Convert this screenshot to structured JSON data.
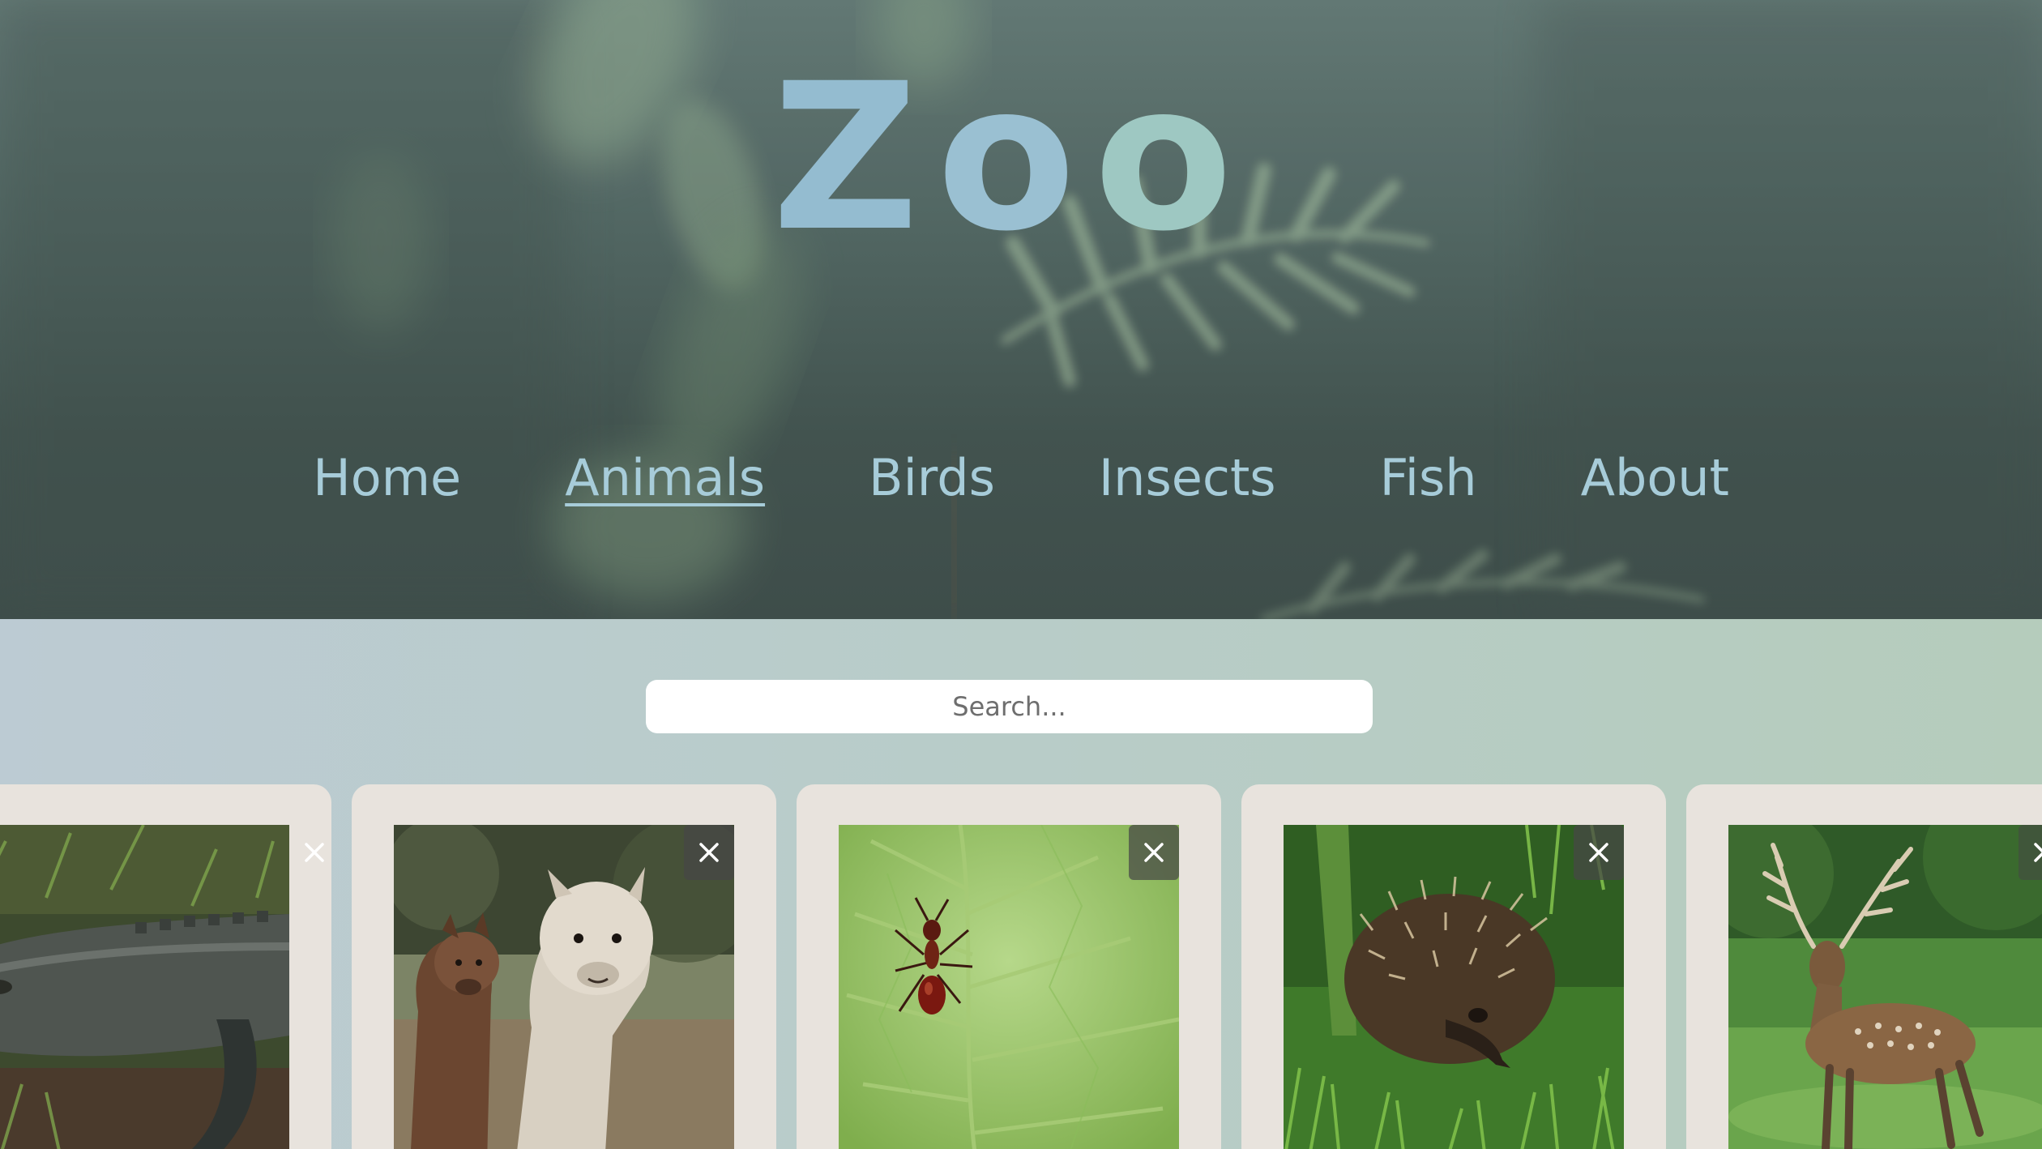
{
  "logo": {
    "letters": [
      "Z",
      "o",
      "o"
    ]
  },
  "nav": {
    "items": [
      {
        "label": "Home"
      },
      {
        "label": "Animals"
      },
      {
        "label": "Birds"
      },
      {
        "label": "Insects"
      },
      {
        "label": "Fish"
      },
      {
        "label": "About"
      }
    ],
    "active": "Animals"
  },
  "search": {
    "placeholder": "Search...",
    "value": ""
  },
  "cards": [
    {
      "animal": "alligator",
      "remove_icon": "close-icon"
    },
    {
      "animal": "alpaca",
      "remove_icon": "close-icon"
    },
    {
      "animal": "ant",
      "remove_icon": "close-icon"
    },
    {
      "animal": "echidna",
      "remove_icon": "close-icon"
    },
    {
      "animal": "deer",
      "remove_icon": "close-icon"
    }
  ],
  "colors": {
    "logo_text": "#94bcd0",
    "nav_text": "#a7ccd9",
    "hero_background": "#4f6460",
    "content_background": "#b8ccc8",
    "card_background": "#e8e3dd",
    "search_background": "#ffffff"
  }
}
